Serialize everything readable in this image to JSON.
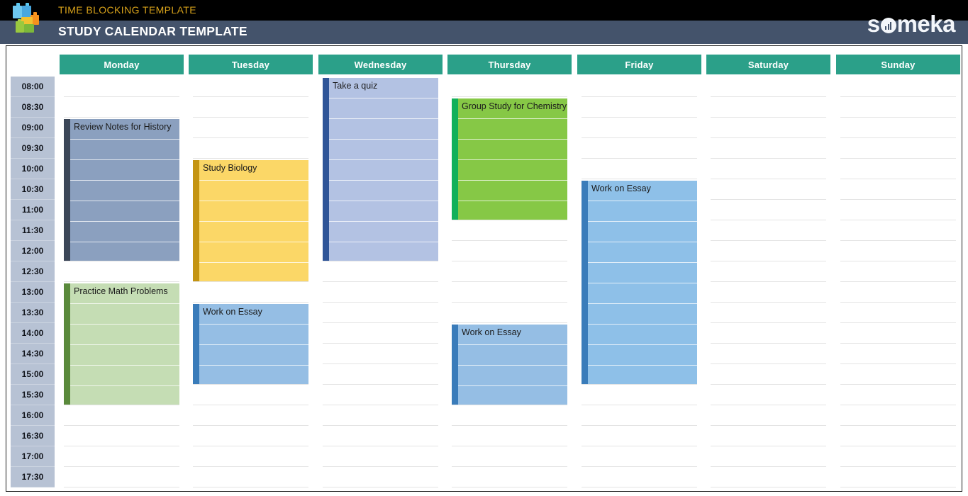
{
  "header": {
    "subtitle": "TIME BLOCKING TEMPLATE",
    "title": "STUDY CALENDAR TEMPLATE",
    "brand": "someka",
    "logo_icon": "blocks-logo-icon",
    "colors": {
      "top_bar": "#000000",
      "title_bar": "#44536b",
      "subtitle_text": "#d8a21a",
      "accent_teal": "#2ba089"
    }
  },
  "calendar": {
    "days": [
      "Monday",
      "Tuesday",
      "Wednesday",
      "Thursday",
      "Friday",
      "Saturday",
      "Sunday"
    ],
    "times": [
      "08:00",
      "08:30",
      "09:00",
      "09:30",
      "10:00",
      "10:30",
      "11:00",
      "11:30",
      "12:00",
      "12:30",
      "13:00",
      "13:30",
      "14:00",
      "14:30",
      "15:00",
      "15:30",
      "16:00",
      "16:30",
      "17:00",
      "17:30"
    ],
    "events": [
      {
        "day": "Monday",
        "title": "Review Notes for History",
        "start": "09:00",
        "end": "12:30",
        "slots": 7,
        "fill": "#8ba0bf",
        "bar": "#3c4758"
      },
      {
        "day": "Monday",
        "title": "Practice Math Problems",
        "start": "13:00",
        "end": "16:00",
        "slots": 6,
        "fill": "#c5ddb4",
        "bar": "#5a8a3c"
      },
      {
        "day": "Tuesday",
        "title": "Study Biology",
        "start": "10:00",
        "end": "13:00",
        "slots": 6,
        "fill": "#fbd767",
        "bar": "#c49412"
      },
      {
        "day": "Tuesday",
        "title": "Work on Essay",
        "start": "13:30",
        "end": "15:30",
        "slots": 4,
        "fill": "#95bee4",
        "bar": "#3a7cba"
      },
      {
        "day": "Wednesday",
        "title": "Take a quiz",
        "start": "08:00",
        "end": "12:30",
        "slots": 9,
        "fill": "#b3c2e3",
        "bar": "#2f5598"
      },
      {
        "day": "Thursday",
        "title": "Group Study for Chemistry",
        "start": "08:30",
        "end": "11:30",
        "slots": 6,
        "fill": "#86c846",
        "bar": "#12b05a"
      },
      {
        "day": "Thursday",
        "title": "Work on Essay",
        "start": "14:00",
        "end": "16:00",
        "slots": 4,
        "fill": "#95bee4",
        "bar": "#3a7cba"
      },
      {
        "day": "Friday",
        "title": "Work on Essay",
        "start": "10:30",
        "end": "15:30",
        "slots": 10,
        "fill": "#8ec0e8",
        "bar": "#3a7cba"
      },
      {
        "day": "Saturday",
        "title": "",
        "start": "",
        "end": "",
        "slots": 0,
        "fill": "",
        "bar": ""
      },
      {
        "day": "Sunday",
        "title": "",
        "start": "",
        "end": "",
        "slots": 0,
        "fill": "",
        "bar": ""
      }
    ]
  }
}
